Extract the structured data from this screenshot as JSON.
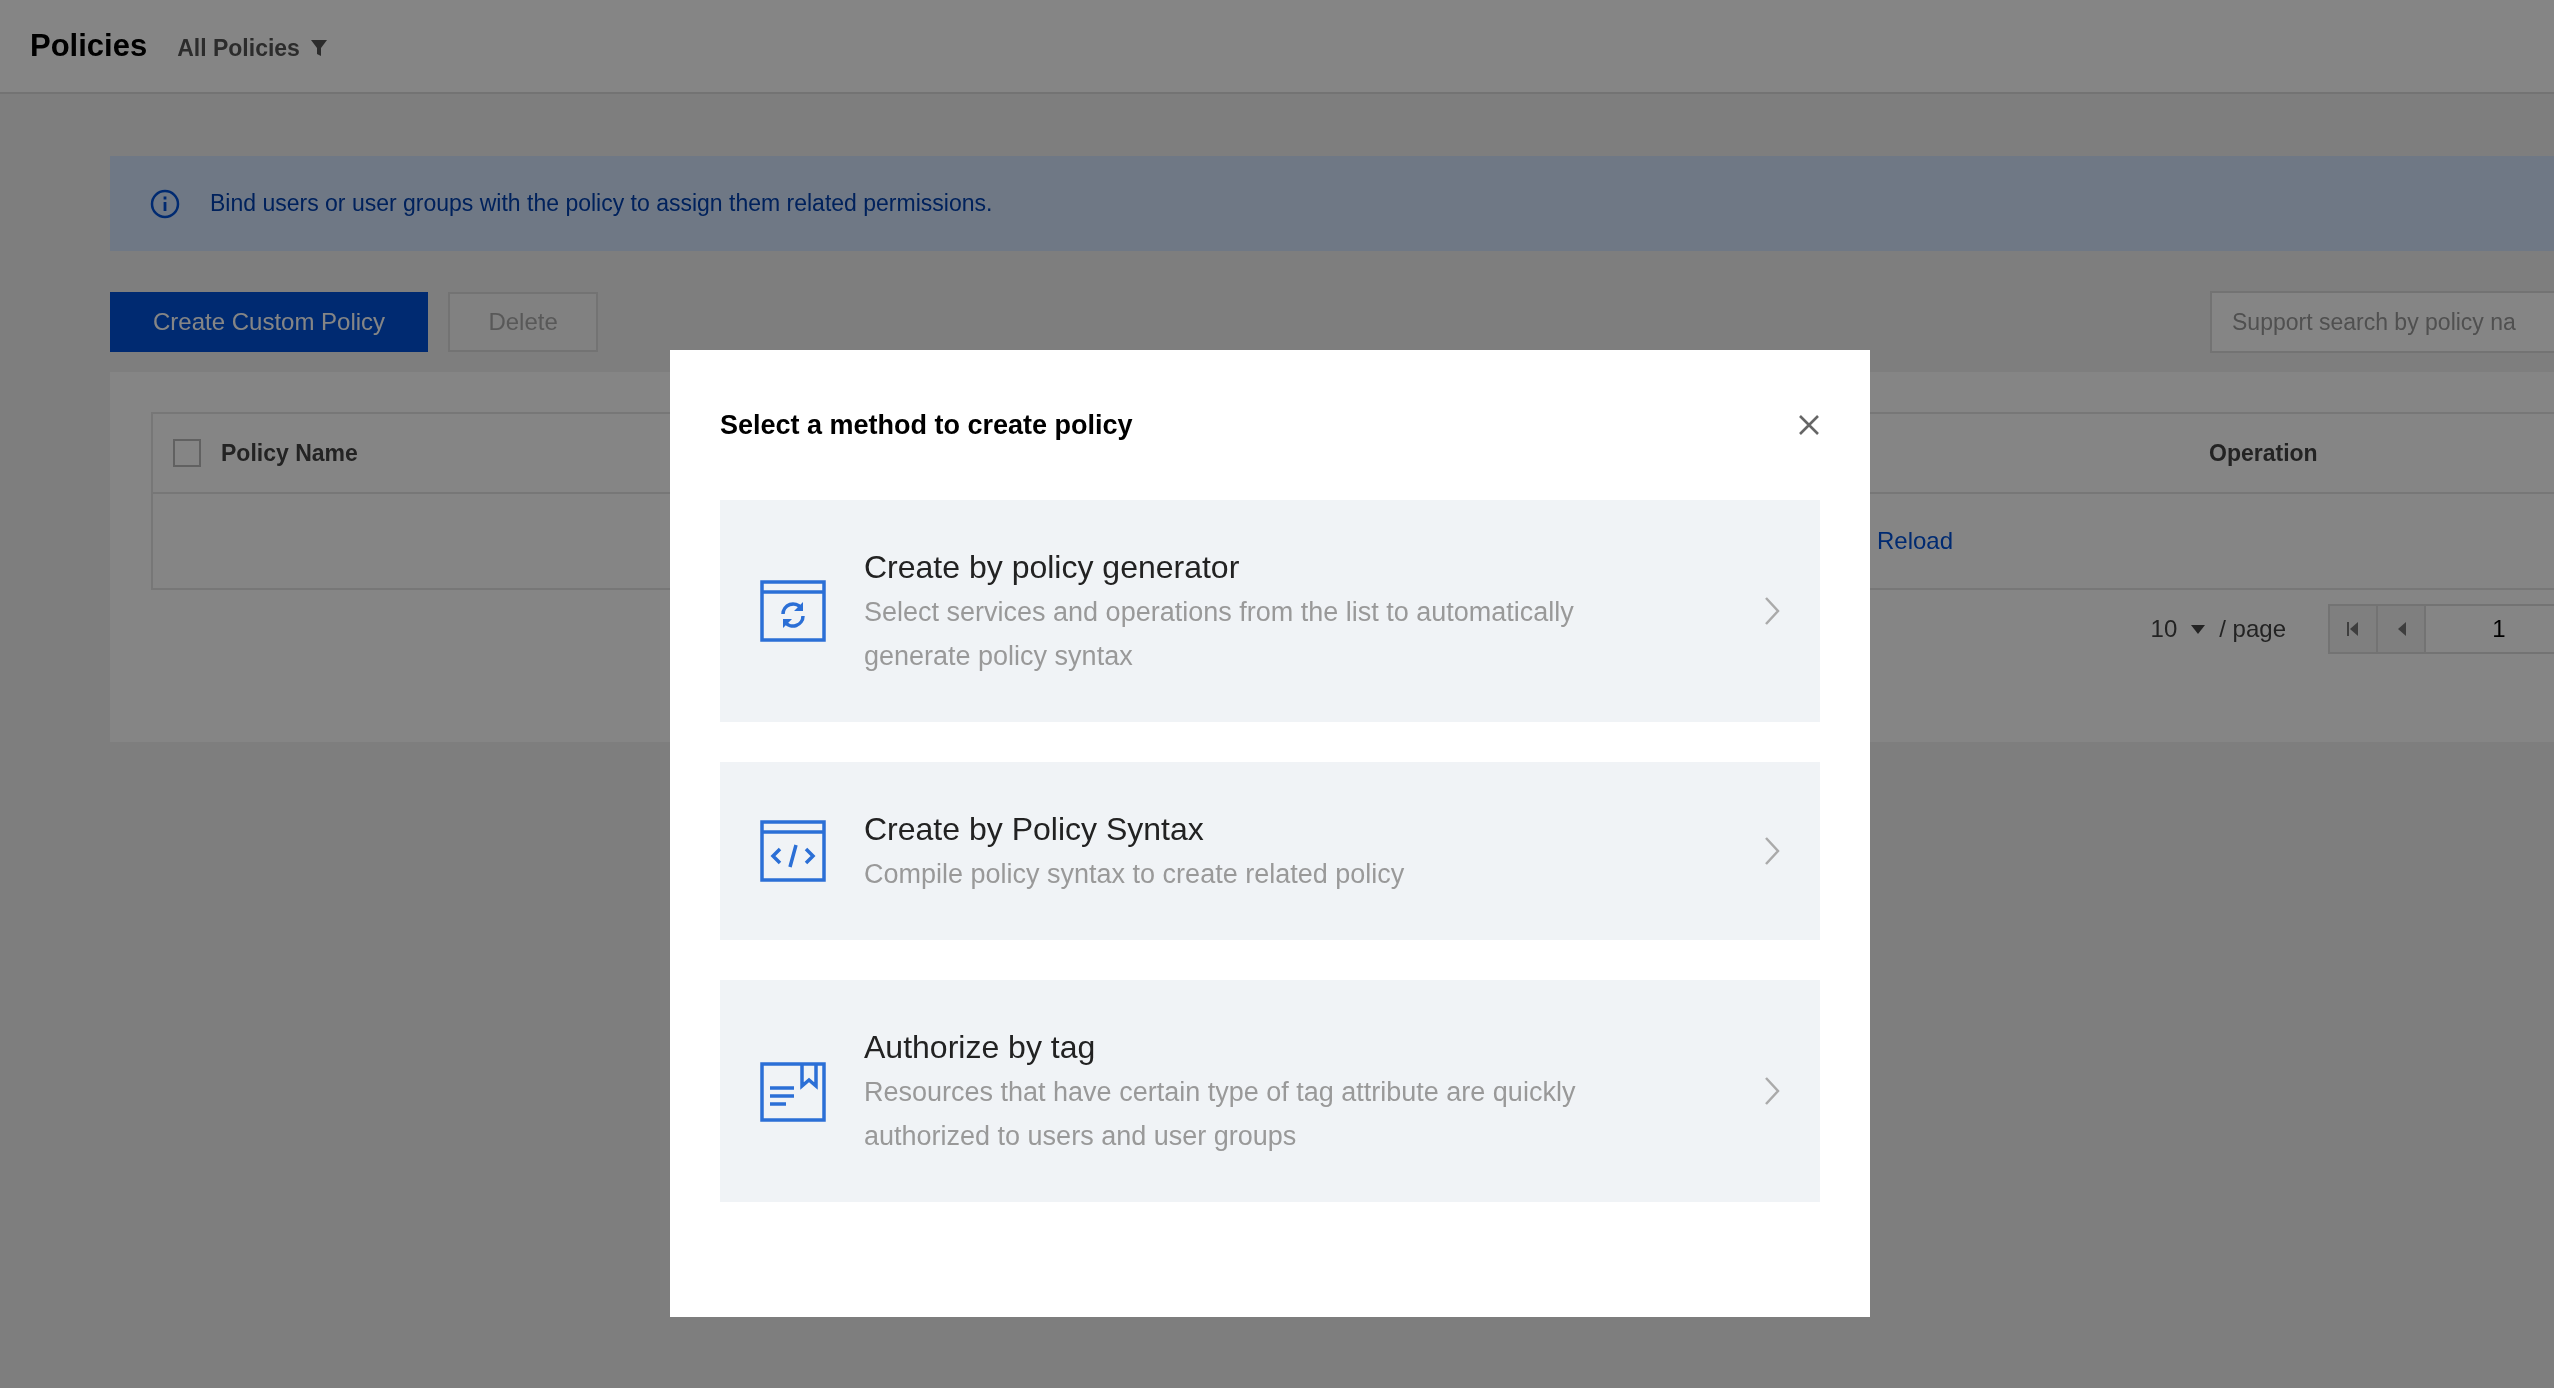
{
  "header": {
    "title": "Policies",
    "filter": "All Policies"
  },
  "notice": "Bind users or user groups with the policy to assign them related permissions.",
  "toolbar": {
    "buttons": [
      {
        "label": "Create Custom Policy",
        "kind": "primary"
      },
      {
        "label": "Delete",
        "kind": "disabled"
      }
    ],
    "search": {
      "placeholder": "Support search by policy na"
    }
  },
  "table": {
    "select_all": {
      "checked": false
    },
    "columns": [
      "Policy Name",
      "Operation"
    ],
    "rows": [
      {
        "action": "Reload"
      }
    ]
  },
  "pagination": {
    "page_size": "10",
    "unit": "/ page",
    "page": "1"
  },
  "dialog": {
    "title": "Select a method to create policy",
    "options": [
      {
        "kind": "generator",
        "title": "Create by policy generator",
        "description": "Select services and operations from the list to automatically generate policy syntax"
      },
      {
        "kind": "syntax",
        "title": "Create by Policy Syntax",
        "description": "Compile policy syntax to create related policy"
      },
      {
        "kind": "tag",
        "title": "Authorize by tag",
        "description": "Resources that have certain type of tag attribute are quickly authorized to users and user groups"
      }
    ]
  }
}
